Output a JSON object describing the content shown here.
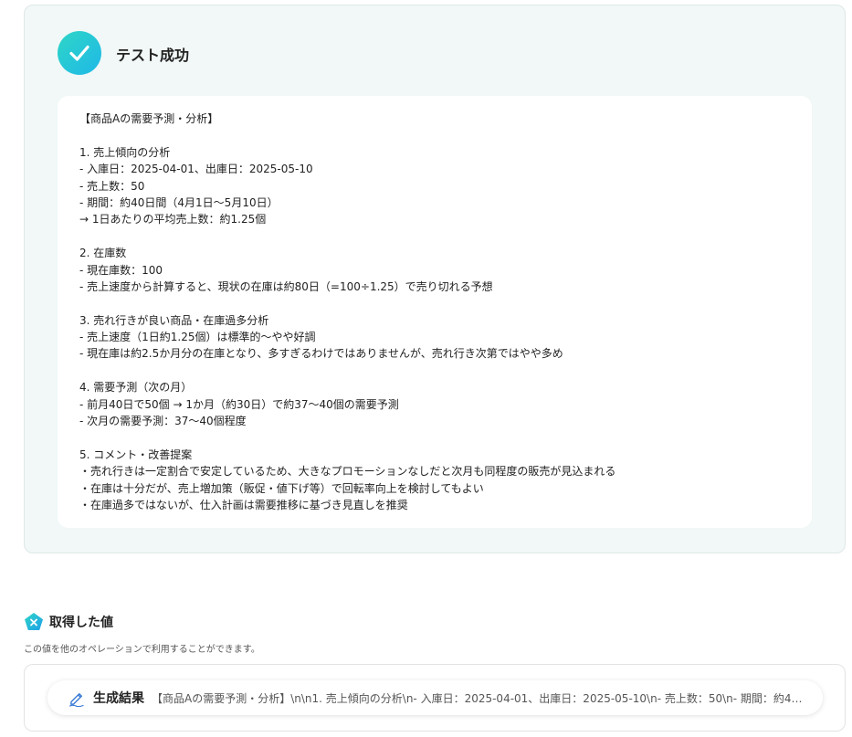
{
  "test_result": {
    "title": "テスト成功",
    "lines": [
      "【商品Aの需要予測・分析】",
      "",
      "1. 売上傾向の分析",
      "- 入庫日：2025-04-01、出庫日：2025-05-10",
      "- 売上数：50",
      "- 期間：約40日間（4月1日〜5月10日）",
      "→ 1日あたりの平均売上数：約1.25個",
      "",
      "2. 在庫数",
      "- 現在庫数：100",
      "- 売上速度から計算すると、現状の在庫は約80日（=100÷1.25）で売り切れる予想",
      "",
      "3. 売れ行きが良い商品・在庫過多分析",
      "- 売上速度（1日約1.25個）は標準的〜やや好調",
      "- 現在庫は約2.5か月分の在庫となり、多すぎるわけではありませんが、売れ行き次第ではやや多め",
      "",
      "4. 需要予測（次の月）",
      "- 前月40日で50個 → 1か月（約30日）で約37〜40個の需要予測",
      "- 次月の需要予測：37〜40個程度",
      "",
      "5. コメント・改善提案",
      "・売れ行きは一定割合で安定しているため、大きなプロモーションなしだと次月も同程度の販売が見込まれる",
      "・在庫は十分だが、売上増加策（販促・値下げ等）で回転率向上を検討してもよい",
      "・在庫過多ではないが、仕入計画は需要推移に基づき見直しを推奨"
    ]
  },
  "retrieved_values": {
    "title": "取得した値",
    "description": "この値を他のオペレーションで利用することができます。",
    "items": [
      {
        "label": "生成結果",
        "value": "【商品Aの需要予測・分析】\\n\\n1. 売上傾向の分析\\n- 入庫日：2025-04-01、出庫日：2025-05-10\\n- 売上数：50\\n- 期間：約40日…"
      }
    ]
  },
  "colors": {
    "accent_start": "#2ed6c6",
    "accent_end": "#1fb8e8",
    "panel_bg": "#f1f8f7"
  },
  "icons": {
    "success": "check-icon",
    "values": "pentagon-x-icon",
    "item": "pen-icon"
  }
}
